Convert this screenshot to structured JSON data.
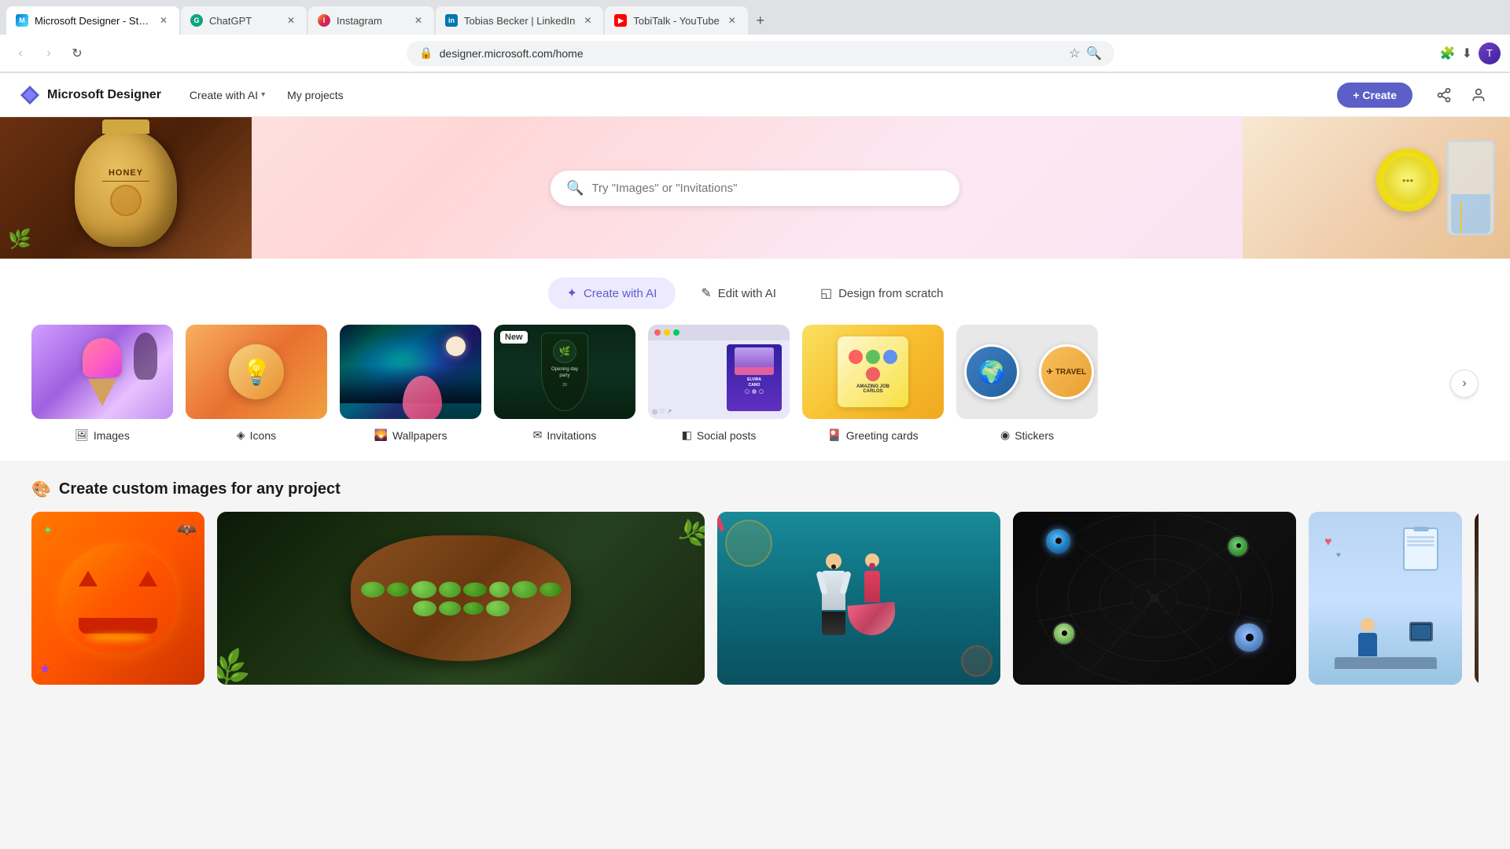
{
  "browser": {
    "tabs": [
      {
        "id": 1,
        "title": "Microsoft Designer - Stunning...",
        "active": true,
        "favicon": "ms"
      },
      {
        "id": 2,
        "title": "ChatGPT",
        "active": false,
        "favicon": "gpt"
      },
      {
        "id": 3,
        "title": "Instagram",
        "active": false,
        "favicon": "ig"
      },
      {
        "id": 4,
        "title": "Tobias Becker | LinkedIn",
        "active": false,
        "favicon": "li"
      },
      {
        "id": 5,
        "title": "TobiTalk - YouTube",
        "active": false,
        "favicon": "yt"
      }
    ],
    "address": "designer.microsoft.com/home"
  },
  "header": {
    "app_name": "Microsoft Designer",
    "nav": [
      {
        "label": "Create with AI",
        "has_dropdown": true
      },
      {
        "label": "My projects",
        "has_dropdown": false
      }
    ],
    "create_btn": "+ Create",
    "icons": [
      "share-icon",
      "profile-icon"
    ]
  },
  "search": {
    "placeholder": "Try \"Images\" or \"Invitations\""
  },
  "tabs": [
    {
      "label": "Create with AI",
      "icon": "✦",
      "active": true
    },
    {
      "label": "Edit with AI",
      "icon": "✎",
      "active": false
    },
    {
      "label": "Design from scratch",
      "icon": "◱",
      "active": false
    }
  ],
  "categories": [
    {
      "label": "Images",
      "icon": "🖼",
      "color": "cat-purple",
      "new": false
    },
    {
      "label": "Icons",
      "icon": "◈",
      "color": "cat-orange",
      "new": false
    },
    {
      "label": "Wallpapers",
      "icon": "🌄",
      "color": "cat-teal",
      "new": false
    },
    {
      "label": "Invitations",
      "icon": "✉",
      "color": "cat-green-dark",
      "new": true
    },
    {
      "label": "Social posts",
      "icon": "◧",
      "color": "cat-purple-card",
      "new": false
    },
    {
      "label": "Greeting cards",
      "icon": "🎴",
      "color": "cat-yellow",
      "new": false
    },
    {
      "label": "Stickers",
      "icon": "◉",
      "color": "cat-gray",
      "new": false
    }
  ],
  "custom_images_section": {
    "title": "Create custom images for any project",
    "icon": "🎨"
  },
  "colors": {
    "accent": "#5b5fc7",
    "active_tab_bg": "#ede9ff",
    "active_tab_text": "#5b5fc7"
  }
}
